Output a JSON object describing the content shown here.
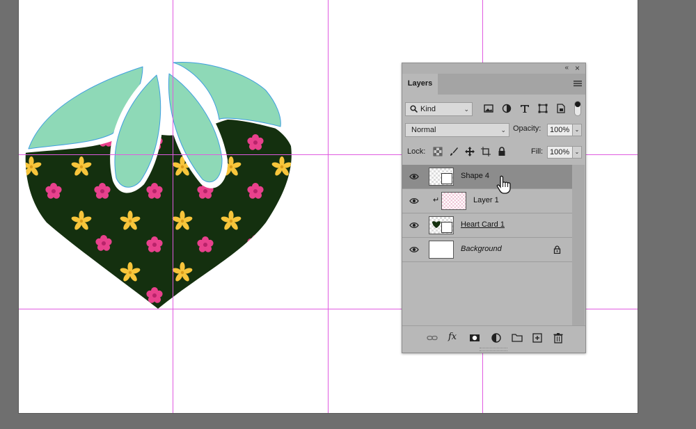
{
  "panel": {
    "tab": "Layers",
    "kind_label": "Kind",
    "blend_mode": "Normal",
    "opacity_label": "Opacity:",
    "opacity_value": "100%",
    "lock_label": "Lock:",
    "fill_label": "Fill:",
    "fill_value": "100%"
  },
  "layers": [
    {
      "name": "Shape 4",
      "selected": true
    },
    {
      "name": "Layer 1",
      "clipped": true
    },
    {
      "name": "Heart Card 1",
      "linked": true
    },
    {
      "name": "Background",
      "locked": true
    }
  ],
  "colors": {
    "guide": "#e05ae0",
    "leaf": "#8ed9b7",
    "leaf_stroke": "#3f9fe0",
    "heart": "#14300f",
    "flower_pink": "#e8418c",
    "flower_yellow": "#f7c53b"
  },
  "icons": [
    "search-icon",
    "pixel-filter-icon",
    "adjustment-filter-icon",
    "type-filter-icon",
    "shape-filter-icon",
    "smart-object-filter-icon",
    "lock-transparent-icon",
    "lock-brush-icon",
    "lock-move-icon",
    "lock-artboard-icon",
    "lock-all-icon",
    "link-icon",
    "fx-icon",
    "mask-icon",
    "adjustment-icon",
    "folder-icon",
    "new-layer-icon",
    "trash-icon",
    "eye-icon",
    "hand-cursor-icon"
  ]
}
